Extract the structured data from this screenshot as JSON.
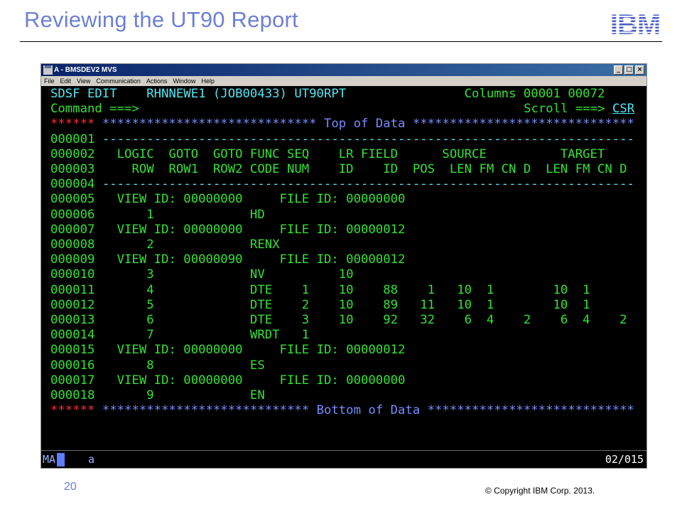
{
  "slide": {
    "title": "Reviewing the UT90 Report",
    "page_number": "20",
    "copyright": "© Copyright  IBM Corp. 2013.",
    "logo_text": "IBM"
  },
  "window": {
    "icon_text": "IBM",
    "title": "A - BMSDEV2 MVS",
    "menu": [
      "File",
      "Edit",
      "View",
      "Communication",
      "Actions",
      "Window",
      "Help"
    ],
    "controls": [
      "_",
      "□",
      "×"
    ]
  },
  "terminal": {
    "header": {
      "left": "SDSF EDIT",
      "dataset": "RHNNEWE1 (JOB00433) UT90RPT",
      "columns_label": "Columns",
      "columns_from": "00001",
      "columns_to": "00072"
    },
    "command": {
      "label": "Command ===>",
      "value": "",
      "scroll_label": "Scroll ===>",
      "scroll_value": "CSR"
    },
    "top_marker": {
      "stars": "******",
      "text": "***************************** Top of Data ******************************"
    },
    "lines": [
      {
        "num": "000001",
        "text": " ------------------------------------------------------------------------"
      },
      {
        "num": "000002",
        "text": "   LOGIC  GOTO  GOTO FUNC SEQ    LR FIELD      SOURCE          TARGET"
      },
      {
        "num": "000003",
        "text": "     ROW  ROW1  ROW2 CODE NUM    ID    ID  POS  LEN FM CN D  LEN FM CN D"
      },
      {
        "num": "000004",
        "text": " ------------------------------------------------------------------------"
      },
      {
        "num": "000005",
        "text": "   VIEW ID: 00000000     FILE ID: 00000000"
      },
      {
        "num": "000006",
        "text": "       1             HD"
      },
      {
        "num": "000007",
        "text": "   VIEW ID: 00000000     FILE ID: 00000012"
      },
      {
        "num": "000008",
        "text": "       2             RENX"
      },
      {
        "num": "000009",
        "text": "   VIEW ID: 00000090     FILE ID: 00000012"
      },
      {
        "num": "000010",
        "text": "       3             NV          10"
      },
      {
        "num": "000011",
        "text": "       4             DTE    1    10    88    1   10  1        10  1"
      },
      {
        "num": "000012",
        "text": "       5             DTE    2    10    89   11   10  1        10  1"
      },
      {
        "num": "000013",
        "text": "       6             DTE    3    10    92   32    6  4    2    6  4    2"
      },
      {
        "num": "000014",
        "text": "       7             WRDT   1"
      },
      {
        "num": "000015",
        "text": "   VIEW ID: 00000000     FILE ID: 00000012"
      },
      {
        "num": "000016",
        "text": "       8             ES"
      },
      {
        "num": "000017",
        "text": "   VIEW ID: 00000000     FILE ID: 00000000"
      },
      {
        "num": "000018",
        "text": "       9             EN"
      }
    ],
    "bottom_marker": {
      "stars": "******",
      "text": "**************************** Bottom of Data ****************************"
    }
  },
  "status": {
    "session": "MA",
    "mode": "a",
    "position": "02/015"
  },
  "colors": {
    "title_blue": "#6d7fd6",
    "terminal_green": "#35e035",
    "terminal_cyan": "#52e6f2",
    "terminal_red": "#ff3030",
    "terminal_blue": "#7a8cff",
    "ibm_blue": "#4a5cc8"
  }
}
